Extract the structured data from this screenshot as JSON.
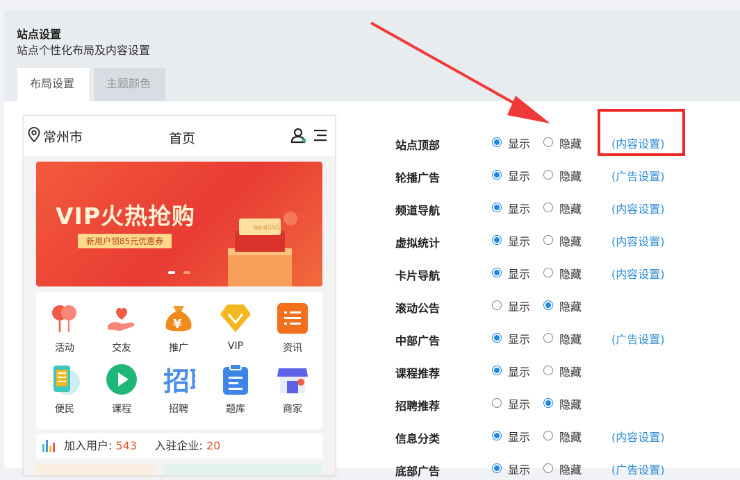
{
  "header": {
    "title": "站点设置",
    "subtitle": "站点个性化布局及内容设置"
  },
  "tabs": [
    {
      "label": "布局设置",
      "active": true
    },
    {
      "label": "主题颜色",
      "active": false
    }
  ],
  "phone": {
    "city": "常州市",
    "page_title": "首页",
    "banner": {
      "title": "VIP火热抢购",
      "tag": "新用户领85元优惠券",
      "box_label": "WindSNS"
    },
    "grid": [
      {
        "label": "活动",
        "icon": "activity-icon"
      },
      {
        "label": "交友",
        "icon": "heart-hand-icon"
      },
      {
        "label": "推广",
        "icon": "money-bag-icon"
      },
      {
        "label": "VIP",
        "icon": "vip-diamond-icon"
      },
      {
        "label": "资讯",
        "icon": "news-icon"
      },
      {
        "label": "便民",
        "icon": "phone-service-icon"
      },
      {
        "label": "课程",
        "icon": "play-icon"
      },
      {
        "label": "招聘",
        "icon": "recruit-icon"
      },
      {
        "label": "题库",
        "icon": "clipboard-icon"
      },
      {
        "label": "商家",
        "icon": "shop-icon"
      }
    ],
    "stats": {
      "users_label": "加入用户:",
      "users_value": "543",
      "companies_label": "入驻企业:",
      "companies_value": "20"
    }
  },
  "options": {
    "show": "显示",
    "hide": "隐藏"
  },
  "settings": [
    {
      "label": "站点顶部",
      "shown": true,
      "link": "(内容设置)"
    },
    {
      "label": "轮播广告",
      "shown": true,
      "link": "(广告设置)"
    },
    {
      "label": "频道导航",
      "shown": true,
      "link": "(内容设置)"
    },
    {
      "label": "虚拟统计",
      "shown": true,
      "link": "(内容设置)"
    },
    {
      "label": "卡片导航",
      "shown": true,
      "link": "(内容设置)"
    },
    {
      "label": "滚动公告",
      "shown": false,
      "link": ""
    },
    {
      "label": "中部广告",
      "shown": true,
      "link": "(广告设置)"
    },
    {
      "label": "课程推荐",
      "shown": true,
      "link": ""
    },
    {
      "label": "招聘推荐",
      "shown": false,
      "link": ""
    },
    {
      "label": "信息分类",
      "shown": true,
      "link": "(内容设置)"
    },
    {
      "label": "底部广告",
      "shown": true,
      "link": "(广告设置)"
    }
  ],
  "colors": {
    "accent": "#1e88e5",
    "link": "#2d8ed8",
    "annotation": "#f02828"
  }
}
